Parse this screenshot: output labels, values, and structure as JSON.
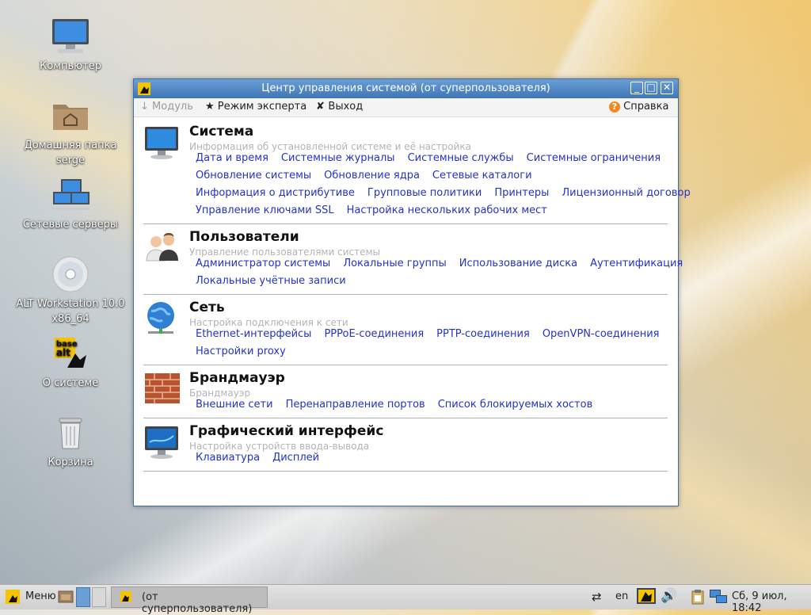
{
  "desktop": {
    "icons": [
      {
        "label": "Компьютер"
      },
      {
        "label": "Домашняя папка serge"
      },
      {
        "label": "Сетевые серверы"
      },
      {
        "label": "ALT Workstation 10.0 x86_64"
      },
      {
        "label": "О системе"
      },
      {
        "label": "Корзина"
      }
    ]
  },
  "window": {
    "title": "Центр управления системой (от суперпользователя)",
    "toolbar": {
      "module": "Модуль",
      "expert": "Режим эксперта",
      "exit": "Выход",
      "help": "Справка"
    },
    "sections": [
      {
        "title": "Система",
        "subtitle": "Информация об установленной системе и её настройка",
        "icon": "monitor-icon",
        "rows": [
          [
            "Дата и время",
            "Системные журналы",
            "Системные службы",
            "Системные ограничения"
          ],
          [
            "Обновление системы",
            "Обновление ядра",
            "Сетевые каталоги"
          ],
          [
            "Информация о дистрибутиве",
            "Групповые политики",
            "Принтеры",
            "Лицензионный договор"
          ],
          [
            "Управление ключами SSL",
            "Настройка нескольких рабочих мест"
          ]
        ]
      },
      {
        "title": "Пользователи",
        "subtitle": "Управление пользователями системы",
        "icon": "users-icon",
        "rows": [
          [
            "Администратор системы",
            "Локальные группы",
            "Использование диска",
            "Аутентификация"
          ],
          [
            "Локальные учётные записи"
          ]
        ]
      },
      {
        "title": "Сеть",
        "subtitle": "Настройка подключения к сети",
        "icon": "globe-network-icon",
        "rows": [
          [
            "Ethernet-интерфейсы",
            "PPPoE-соединения",
            "PPTP-соединения",
            "OpenVPN-соединения"
          ],
          [
            "Настройки proxy"
          ]
        ]
      },
      {
        "title": "Брандмауэр",
        "subtitle": "Брандмауэр",
        "icon": "firewall-icon",
        "rows": [
          [
            "Внешние сети",
            "Перенаправление портов",
            "Список блокируемых хостов"
          ]
        ]
      },
      {
        "title": "Графический интерфейс",
        "subtitle": "Настройка устройств ввода-вывода",
        "icon": "display-icon",
        "rows": [
          [
            "Клавиатура",
            "Дисплей"
          ]
        ]
      }
    ]
  },
  "taskbar": {
    "menu": "Меню",
    "task": "(от суперпользователя)",
    "lang": "en",
    "clock": "Сб, 9 июл, 18:42"
  },
  "colors": {
    "link": "#2333c8",
    "titlebar": "#4a80c0",
    "subtitle": "#b4b4b4"
  }
}
